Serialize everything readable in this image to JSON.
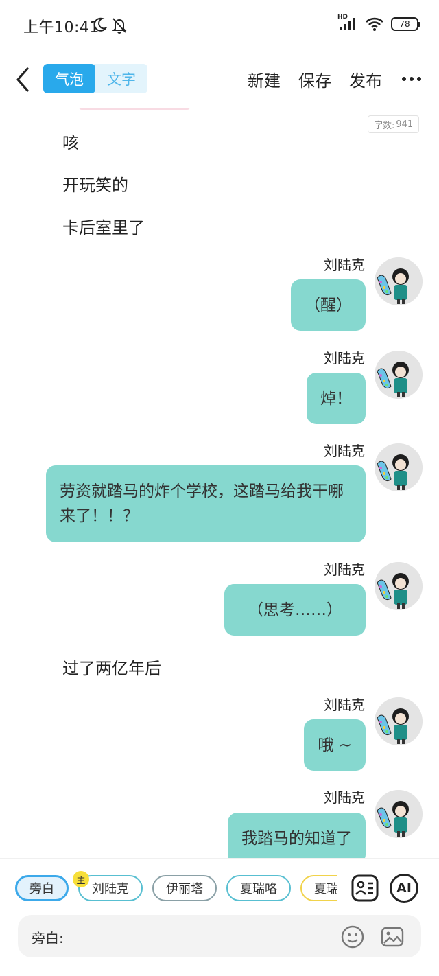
{
  "status_bar": {
    "time": "上午10:41",
    "network": "HD",
    "battery": "78"
  },
  "toolbar": {
    "modes": [
      "气泡",
      "文字"
    ],
    "active_mode": "气泡",
    "new_label": "新建",
    "save_label": "保存",
    "publish_label": "发布"
  },
  "chat": {
    "word_count_label": "字数:",
    "word_count": "941",
    "narrations": [
      "咳",
      "开玩笑的",
      "卡后室里了",
      "过了两亿年后"
    ],
    "messages": [
      {
        "name": "刘陆克",
        "text": "（醒）"
      },
      {
        "name": "刘陆克",
        "text": "焯！"
      },
      {
        "name": "刘陆克",
        "text": "劳资就踏马的炸个学校，这踏马给我干哪来了！！？"
      },
      {
        "name": "刘陆克",
        "text": "（思考……）"
      },
      {
        "name": "刘陆克",
        "text": "哦 ~"
      },
      {
        "name": "刘陆克",
        "text": "我踏马的知道了"
      }
    ]
  },
  "characters": {
    "items": [
      "旁白",
      "刘陆克",
      "伊丽塔",
      "夏瑞咯",
      "夏瑞"
    ],
    "selected": "旁白",
    "main_badge": "主",
    "ai_label": "AI"
  },
  "input": {
    "prefix": "旁白:",
    "value": ""
  },
  "colors": {
    "accent": "#29a9eb",
    "bubble": "#86d8cf",
    "chip_border": "#58bfd1"
  }
}
